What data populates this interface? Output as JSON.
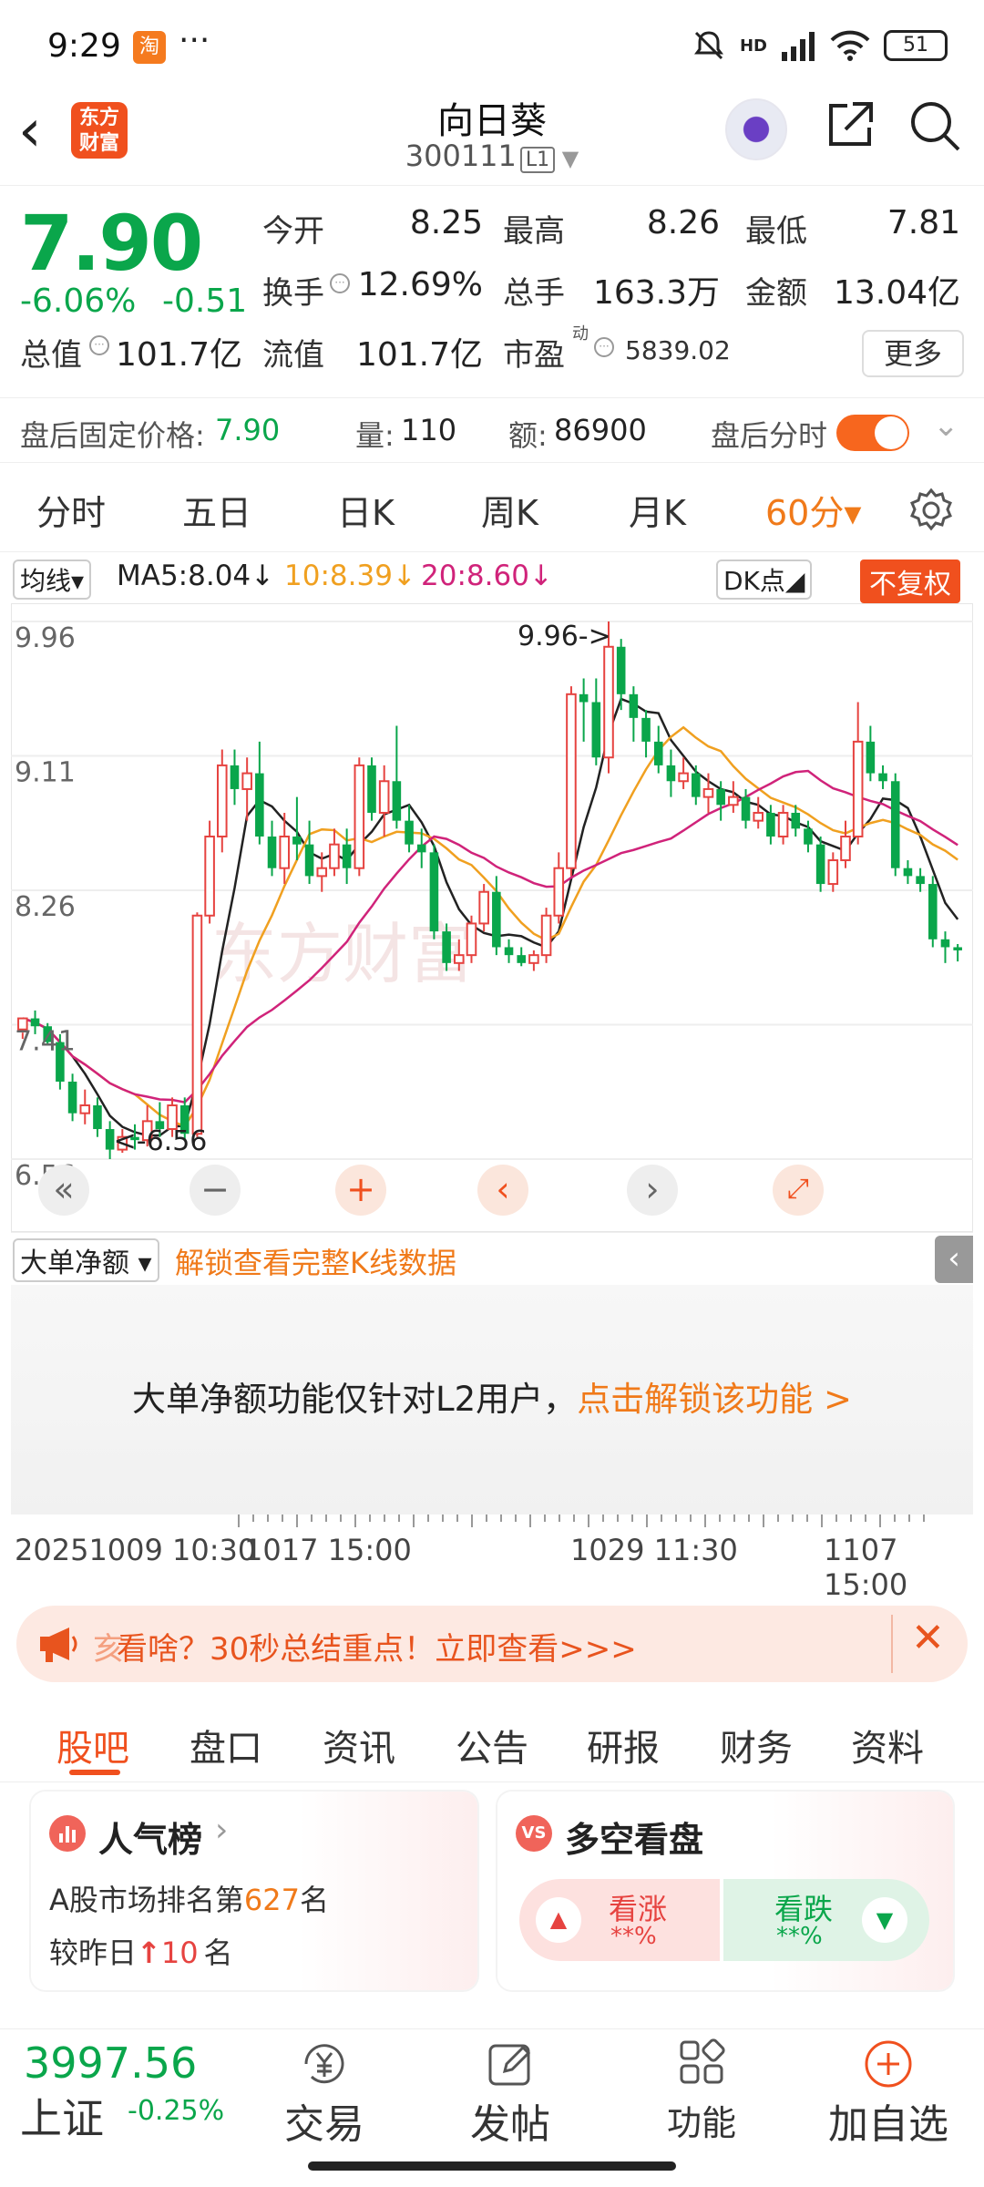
{
  "status_bar": {
    "time": "9:29",
    "taobao_icon": "淘",
    "dots": "···",
    "network": "HD",
    "battery": "51"
  },
  "header": {
    "logo_text_1": "东方",
    "logo_text_2": "财富",
    "stock_name": "向日葵",
    "stock_code": "300111",
    "level_tag": "L1"
  },
  "quote": {
    "price": "7.90",
    "change_pct": "-6.06%",
    "change_abs": "-0.51",
    "open_label": "今开",
    "open": "8.25",
    "high_label": "最高",
    "high": "8.26",
    "low_label": "最低",
    "low": "7.81",
    "turnover_label": "换手",
    "turnover": "12.69%",
    "volume_label": "总手",
    "volume": "163.3万",
    "amount_label": "金额",
    "amount": "13.04亿",
    "mktcap_label": "总值",
    "mktcap": "101.7亿",
    "float_label": "流值",
    "float_cap": "101.7亿",
    "pe_label": "市盈",
    "pe_sup": "动",
    "pe": "5839.02",
    "more_label": "更多"
  },
  "after_hours": {
    "label": "盘后固定价格:",
    "price": "7.90",
    "vol_label": "量:",
    "vol": "110",
    "amt_label": "额:",
    "amt": "86900",
    "toggle_label": "盘后分时",
    "toggle_on": true
  },
  "period_tabs": [
    {
      "label": "分时"
    },
    {
      "label": "五日"
    },
    {
      "label": "日K"
    },
    {
      "label": "周K"
    },
    {
      "label": "月K"
    },
    {
      "label": "60分▾"
    }
  ],
  "ma_row": {
    "ma_select": "均线▾",
    "ma5": "MA5:8.04↓",
    "ma10": "10:8.39↓",
    "ma20": "20:8.60↓",
    "dk": "DK点◢",
    "fq": "不复权",
    "colors": {
      "ma5": "#222222",
      "ma10": "#f0a020",
      "ma20": "#d0237a",
      "up": "#e64340",
      "down": "#0aa64b"
    }
  },
  "chart_data": {
    "type": "candlestick",
    "y_ticks": [
      "9.96",
      "9.11",
      "8.26",
      "7.41",
      "6.56"
    ],
    "ylim": [
      6.56,
      9.96
    ],
    "high_marker": "9.96->",
    "low_marker": "<-6.56",
    "x_labels": [
      "20251009 10:30",
      "1017 15:00",
      "1029 11:30",
      "1107 15:00"
    ],
    "watermark": "东方财富",
    "candles": [
      [
        7.38,
        7.45,
        7.36,
        7.32
      ],
      [
        7.45,
        7.4,
        7.5,
        7.35
      ],
      [
        7.4,
        7.3,
        7.42,
        7.28
      ],
      [
        7.3,
        7.05,
        7.35,
        7.0
      ],
      [
        7.05,
        6.85,
        7.1,
        6.8
      ],
      [
        6.85,
        6.9,
        7.0,
        6.78
      ],
      [
        6.9,
        6.75,
        6.95,
        6.7
      ],
      [
        6.75,
        6.62,
        6.8,
        6.56
      ],
      [
        6.62,
        6.7,
        6.75,
        6.6
      ],
      [
        6.7,
        6.68,
        6.78,
        6.62
      ],
      [
        6.68,
        6.8,
        6.9,
        6.64
      ],
      [
        6.8,
        6.75,
        6.92,
        6.7
      ],
      [
        6.75,
        6.9,
        6.95,
        6.7
      ],
      [
        6.9,
        6.72,
        6.95,
        6.68
      ],
      [
        6.72,
        8.1,
        8.12,
        6.7
      ],
      [
        8.1,
        8.6,
        8.7,
        8.05
      ],
      [
        8.6,
        9.05,
        9.15,
        8.5
      ],
      [
        9.05,
        8.9,
        9.15,
        8.8
      ],
      [
        8.9,
        9.0,
        9.1,
        8.7
      ],
      [
        9.0,
        8.6,
        9.2,
        8.55
      ],
      [
        8.6,
        8.4,
        8.7,
        8.35
      ],
      [
        8.4,
        8.6,
        8.75,
        8.3
      ],
      [
        8.6,
        8.55,
        8.85,
        8.45
      ],
      [
        8.55,
        8.35,
        8.7,
        8.3
      ],
      [
        8.35,
        8.4,
        8.5,
        8.25
      ],
      [
        8.4,
        8.55,
        8.65,
        8.35
      ],
      [
        8.55,
        8.4,
        8.65,
        8.3
      ],
      [
        8.4,
        9.05,
        9.1,
        8.35
      ],
      [
        9.05,
        8.75,
        9.1,
        8.7
      ],
      [
        8.75,
        8.95,
        9.05,
        8.6
      ],
      [
        8.95,
        8.7,
        9.3,
        8.65
      ],
      [
        8.7,
        8.55,
        8.8,
        8.5
      ],
      [
        8.55,
        8.5,
        8.65,
        8.4
      ],
      [
        8.5,
        8.0,
        8.55,
        7.95
      ],
      [
        8.0,
        7.8,
        8.05,
        7.75
      ],
      [
        7.8,
        7.85,
        7.95,
        7.75
      ],
      [
        7.85,
        8.05,
        8.1,
        7.8
      ],
      [
        8.05,
        8.25,
        8.3,
        8.0
      ],
      [
        8.25,
        7.9,
        8.35,
        7.85
      ],
      [
        7.9,
        7.85,
        7.95,
        7.8
      ],
      [
        7.85,
        7.8,
        7.9,
        7.78
      ],
      [
        7.8,
        7.85,
        7.88,
        7.75
      ],
      [
        7.85,
        8.1,
        8.15,
        7.8
      ],
      [
        8.1,
        8.4,
        8.5,
        8.05
      ],
      [
        8.4,
        9.5,
        9.55,
        8.35
      ],
      [
        9.5,
        9.45,
        9.6,
        9.2
      ],
      [
        9.45,
        9.1,
        9.6,
        9.05
      ],
      [
        9.1,
        9.8,
        9.96,
        9.0
      ],
      [
        9.8,
        9.5,
        9.85,
        9.4
      ],
      [
        9.5,
        9.35,
        9.55,
        9.2
      ],
      [
        9.35,
        9.2,
        9.4,
        9.1
      ],
      [
        9.2,
        9.05,
        9.3,
        9.0
      ],
      [
        9.05,
        8.95,
        9.15,
        8.85
      ],
      [
        8.95,
        9.0,
        9.1,
        8.9
      ],
      [
        9.0,
        8.85,
        9.05,
        8.8
      ],
      [
        8.85,
        8.9,
        9.0,
        8.75
      ],
      [
        8.9,
        8.8,
        8.95,
        8.7
      ],
      [
        8.8,
        8.85,
        8.95,
        8.75
      ],
      [
        8.85,
        8.7,
        8.9,
        8.65
      ],
      [
        8.7,
        8.75,
        8.85,
        8.65
      ],
      [
        8.75,
        8.6,
        8.8,
        8.55
      ],
      [
        8.6,
        8.75,
        8.8,
        8.55
      ],
      [
        8.75,
        8.65,
        8.8,
        8.6
      ],
      [
        8.65,
        8.55,
        8.7,
        8.5
      ],
      [
        8.55,
        8.3,
        8.6,
        8.25
      ],
      [
        8.3,
        8.45,
        8.5,
        8.25
      ],
      [
        8.45,
        8.6,
        8.7,
        8.4
      ],
      [
        8.6,
        9.2,
        9.45,
        8.55
      ],
      [
        9.2,
        9.0,
        9.3,
        8.95
      ],
      [
        9.0,
        8.95,
        9.05,
        8.9
      ],
      [
        8.95,
        8.4,
        9.0,
        8.35
      ],
      [
        8.4,
        8.35,
        8.45,
        8.3
      ],
      [
        8.35,
        8.3,
        8.4,
        8.25
      ],
      [
        8.3,
        7.95,
        8.35,
        7.9
      ],
      [
        7.95,
        7.9,
        8.0,
        7.8
      ],
      [
        7.9,
        7.88,
        7.92,
        7.81
      ]
    ]
  },
  "big_order": {
    "select": "大单净额",
    "unlock_link": "解锁查看完整K线数据",
    "message": "大单净额功能仅针对L2用户，",
    "message_link": "点击解锁该功能 >"
  },
  "banner": {
    "text": "看啥？30秒总结重点！立即查看>>>",
    "prefix": "亥"
  },
  "content_tabs": [
    {
      "label": "股吧"
    },
    {
      "label": "盘口"
    },
    {
      "label": "资讯"
    },
    {
      "label": "公告"
    },
    {
      "label": "研报"
    },
    {
      "label": "财务"
    },
    {
      "label": "资料"
    }
  ],
  "hot_card": {
    "title": "人气榜",
    "rank_prefix": "A股市场排名第",
    "rank": "627",
    "rank_suffix": "名",
    "cmp_prefix": "较昨日",
    "cmp_value": "10",
    "cmp_suffix": "名"
  },
  "vs_card": {
    "title": "多空看盘",
    "badge": "VS",
    "up_label": "看涨",
    "up_value": "**%",
    "down_label": "看跌",
    "down_value": "**%"
  },
  "bottom_nav": {
    "index_value": "3997.56",
    "index_name": "上证",
    "index_change": "-0.25%",
    "trade": "交易",
    "post": "发帖",
    "functions": "功能",
    "add_watch": "加自选"
  }
}
